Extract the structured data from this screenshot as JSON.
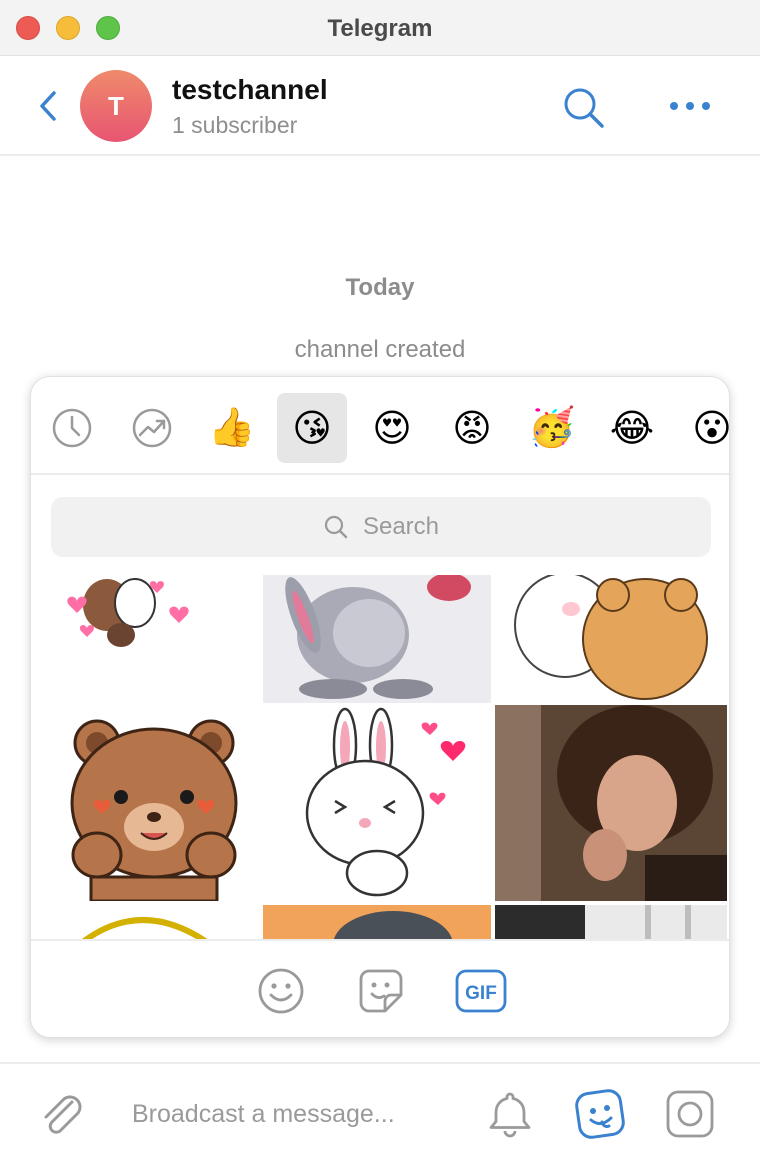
{
  "window": {
    "title": "Telegram"
  },
  "header": {
    "avatar_letter": "T",
    "channel_name": "testchannel",
    "subscribers": "1 subscriber"
  },
  "chat": {
    "date_label": "Today",
    "service_message": "channel created"
  },
  "panel": {
    "categories": [
      {
        "name": "recent",
        "glyph": ""
      },
      {
        "name": "trending",
        "glyph": ""
      },
      {
        "name": "thumbs-up",
        "glyph": "👍"
      },
      {
        "name": "kiss",
        "glyph": "😘",
        "active": true
      },
      {
        "name": "heart-eyes",
        "glyph": "😍"
      },
      {
        "name": "angry",
        "glyph": "😡"
      },
      {
        "name": "party",
        "glyph": "🥳"
      },
      {
        "name": "laughing",
        "glyph": "😂"
      },
      {
        "name": "surprised",
        "glyph": "😮"
      }
    ],
    "search_placeholder": "Search",
    "bottom_tabs": [
      {
        "name": "emoji-tab",
        "active": false
      },
      {
        "name": "stickers-tab",
        "active": false
      },
      {
        "name": "gif-tab",
        "active": true,
        "label": "GIF"
      }
    ]
  },
  "composer": {
    "placeholder": "Broadcast a message..."
  },
  "colors": {
    "accent": "#3a82d0",
    "muted": "#8e8e8e",
    "active_tab_bg": "#e6e6e6"
  }
}
